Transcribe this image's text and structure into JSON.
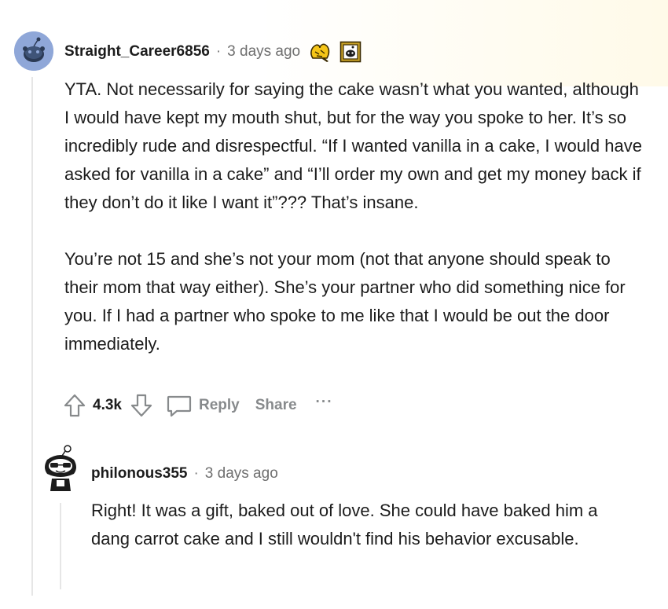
{
  "comment": {
    "username": "Straight_Career6856",
    "separator": "·",
    "timestamp": "3 days ago",
    "paragraphs": [
      "YTA. Not necessarily for saying the cake wasn’t what you wanted, although I would have kept my mouth shut, but for the way you spoke to her. It’s so incredibly rude and disrespectful. “If I wanted vanilla in a cake, I would have asked for vanilla in a cake” and “I’ll order my own and get my money back if they don’t do it like I want it”??? That’s insane.",
      "You’re not 15 and she’s not your mom (not that anyone should speak to their mom that way either). She’s your partner who did something nice for you. If I had a partner who spoke to me like that I would be out the door immediately."
    ],
    "votes": "4.3k",
    "reply_label": "Reply",
    "share_label": "Share",
    "more_label": "···",
    "awards": [
      "gold-hands-award-icon",
      "framed-snoo-award-icon"
    ]
  },
  "reply": {
    "username": "philonous355",
    "separator": "·",
    "timestamp": "3 days ago",
    "paragraphs": [
      "Right! It was a gift, baked out of love. She could have baked him a dang carrot cake and I still wouldn't find his behavior excusable."
    ]
  },
  "colors": {
    "text": "#1c1c1c",
    "meta": "#6f6f6f",
    "action": "#878a8c",
    "thread_line": "#e6e6e6",
    "avatar_bg": "#8fa7d8"
  }
}
